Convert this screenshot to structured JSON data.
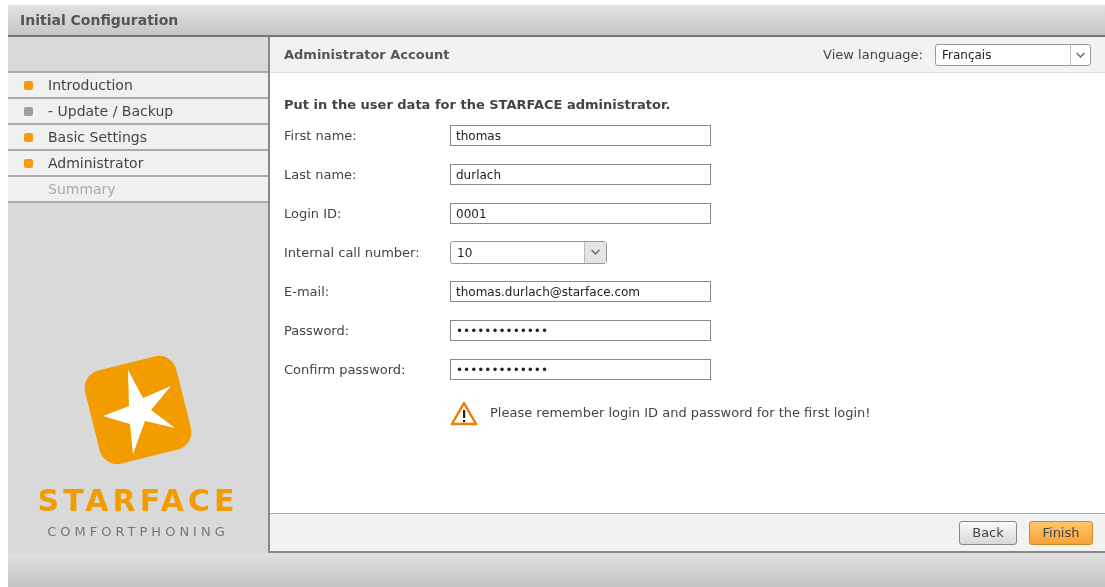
{
  "window": {
    "title": "Initial Configuration"
  },
  "sidebar": {
    "items": [
      {
        "label": "Introduction",
        "color": "#f39c12",
        "disabled": false
      },
      {
        "label": "- Update / Backup",
        "color": "#9e9e9e",
        "disabled": false
      },
      {
        "label": "Basic Settings",
        "color": "#f39c12",
        "disabled": false
      },
      {
        "label": "Administrator",
        "color": "#f39c12",
        "disabled": false
      },
      {
        "label": "Summary",
        "disabled": true
      }
    ],
    "logo": {
      "name": "STARFACE",
      "tagline": "COMFORTPHONING"
    }
  },
  "header": {
    "title": "Administrator Account",
    "language_label": "View language:",
    "language_value": "Français"
  },
  "intro": "Put in the user data for the STARFACE administrator.",
  "fields": [
    {
      "kind": "text",
      "label": "First name:",
      "value": "thomas"
    },
    {
      "kind": "text",
      "label": "Last name:",
      "value": "durlach"
    },
    {
      "kind": "text",
      "label": "Login ID:",
      "value": "0001"
    },
    {
      "kind": "select",
      "label": "Internal call number:",
      "value": "10"
    },
    {
      "kind": "text",
      "label": "E-mail:",
      "value": "thomas.durlach@starface.com"
    },
    {
      "kind": "text",
      "label": "Password:",
      "value": "•••••••••••••"
    },
    {
      "kind": "text",
      "label": "Confirm password:",
      "value": "•••••••••••••"
    }
  ],
  "warning": "Please remember login ID and password for the first login!",
  "buttons": [
    {
      "label": "Back",
      "primary": false
    },
    {
      "label": "Finish",
      "primary": true
    }
  ]
}
